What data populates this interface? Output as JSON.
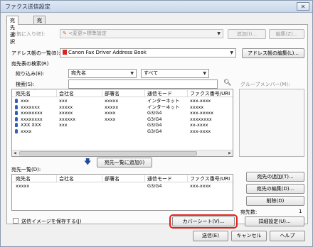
{
  "window": {
    "title": "ファクス送信設定",
    "close_label": "✕"
  },
  "tabs": [
    {
      "label": "宛先選択"
    },
    {
      "label": "宛先入力"
    }
  ],
  "favorites": {
    "label": "お気に入り(E):",
    "value": "<変更>標準設定",
    "add_label": "追加(I)...",
    "edit_label": "編集(Z)..."
  },
  "addressbook": {
    "label": "アドレス帳の一覧(B):",
    "value": "Canon Fax Driver Address Book",
    "edit_label": "アドレス帳の編集(L)..."
  },
  "search": {
    "section_label": "宛先表の検索(R)",
    "filter_label": "絞り込み(E):",
    "filter_field": "宛先名",
    "filter_value": "すべて",
    "search_label": "検索(S):",
    "search_value": ""
  },
  "group": {
    "label": "グループメンバー(M):"
  },
  "address_table": {
    "columns": [
      "宛先名",
      "会社名",
      "部署名",
      "通信モード",
      "ファクス番号/URI"
    ],
    "rows": [
      [
        "xxx",
        "xxx",
        "xxxxx",
        "インターネット",
        "xxx-xxxx"
      ],
      [
        "xxxxxxx",
        "xxxxx",
        "xxxxx",
        "インターネット",
        "xxxxx"
      ],
      [
        "xxxxxxxx",
        "xxxxx",
        "xxxx",
        "G3/G4",
        "xxx-xxxxx"
      ],
      [
        "xxxxxxxx",
        "xxxxxx",
        "xxxx",
        "G3/G4",
        "xxxxxxxx"
      ],
      [
        "XXX XXX",
        "xxx",
        "",
        "G3/G4",
        "xx-xxxx"
      ],
      [
        "xxxx",
        "",
        "",
        "G3/G4",
        "xxx-xxxx"
      ]
    ]
  },
  "add_to_list_label": "宛先一覧に追加(I)",
  "dest_list": {
    "label": "宛先一覧(D):",
    "columns": [
      "宛先名",
      "会社名",
      "部署名",
      "通信モード",
      "ファクス番号/URI"
    ],
    "rows": [
      [
        "xxxxx",
        "",
        "",
        "G3/G4",
        "xxx-xxxx"
      ]
    ]
  },
  "side_buttons": {
    "add_dest": "宛先の追加(T)...",
    "edit_dest": "宛先の編集(D)...",
    "delete": "削除(D)"
  },
  "dest_count": {
    "label": "宛先数:",
    "value": "1"
  },
  "save_image": {
    "label": "送信イメージを保存する(J)",
    "checked": false
  },
  "cover_sheet_label": "カバーシート(V)...",
  "detail_label": "詳細設定(U)...",
  "footer": {
    "send": "送信(E)",
    "cancel": "キャンセル",
    "help": "ヘルプ"
  }
}
